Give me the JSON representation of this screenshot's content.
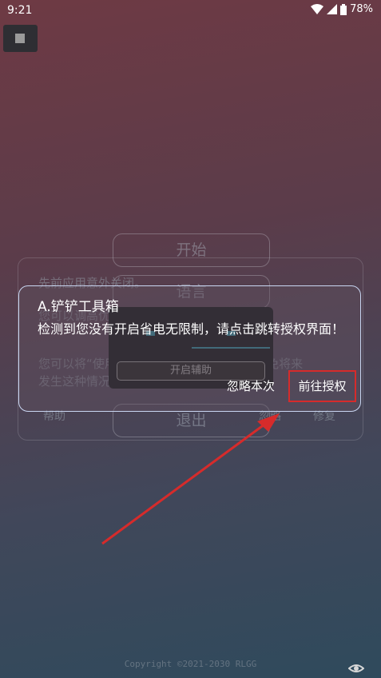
{
  "status_bar": {
    "time": "9:21",
    "battery": "78%"
  },
  "background_menu": {
    "start": "开始",
    "language": "语言",
    "exit": "退出",
    "help": "帮助",
    "ignore": "忽略",
    "repair": "修复",
    "message_lines": [
      "先前应用意外关闭。",
      "您可以调高优先运行时间级别以避免这种情",
      "您可以将“使用省电模式”设置为“不”，以避免将来",
      "发生这种情况。"
    ]
  },
  "assist_popup": {
    "button": "开启辅助"
  },
  "dialog": {
    "title": "A.铲铲工具箱",
    "message": "检测到您没有开启省电无限制，请点击跳转授权界面！",
    "ignore_once": "忽略本次",
    "go_authorize": "前往授权"
  },
  "footer": {
    "copyright": "Copyright ©2021-2030 RLGG"
  },
  "colors": {
    "annotation_red": "#d62b2b",
    "dialog_border": "#c9d6f2"
  }
}
